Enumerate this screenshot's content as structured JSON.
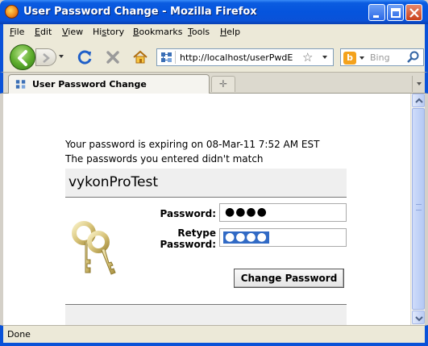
{
  "window": {
    "title": "User Password Change - Mozilla Firefox"
  },
  "menu": {
    "items": [
      {
        "label": "File",
        "underline": "F"
      },
      {
        "label": "Edit",
        "underline": "E"
      },
      {
        "label": "View",
        "underline": "V"
      },
      {
        "label": "History",
        "underline": "s"
      },
      {
        "label": "Bookmarks",
        "underline": "B"
      },
      {
        "label": "Tools",
        "underline": "T"
      },
      {
        "label": "Help",
        "underline": "H"
      }
    ]
  },
  "navbar": {
    "url": "http://localhost/userPwdExp",
    "search_placeholder": "Bing",
    "icons": [
      "back-arrow-icon",
      "forward-arrow-icon",
      "reload-icon",
      "stop-icon",
      "home-icon",
      "bookmark-star-icon",
      "search-magnifier-icon"
    ]
  },
  "tabs": [
    {
      "label": "User Password Change",
      "active": true
    }
  ],
  "page": {
    "expiry_message": "Your password is expiring on 08-Mar-11 7:52 AM EST",
    "error_message": "The passwords you entered didn't match",
    "username": "vykonProTest",
    "password_label": "Password:",
    "retype_label_line1": "Retype",
    "retype_label_line2": "Password:",
    "password_value": "●●●●",
    "retype_value": "●●●●",
    "submit_label": "Change Password"
  },
  "status": {
    "text": "Done"
  },
  "colors": {
    "titlebar": "#0a52d8",
    "selection": "#316ac5"
  }
}
